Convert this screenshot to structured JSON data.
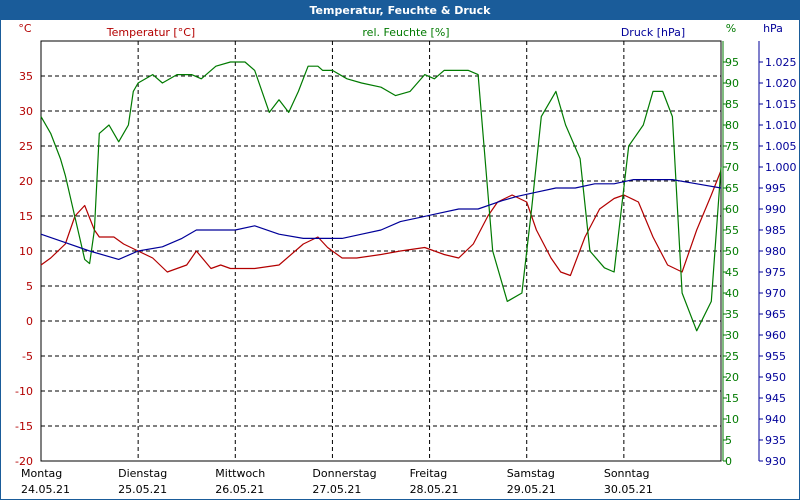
{
  "window": {
    "title": "Temperatur, Feuchte & Druck"
  },
  "colors": {
    "frame": "#1a5c9a",
    "temperature": "#b30000",
    "humidity": "#007a00",
    "pressure": "#000099",
    "grid": "#000000"
  },
  "chart_data": {
    "type": "line",
    "title": "Temperatur, Feuchte & Druck",
    "grid": true,
    "x_labels": [
      {
        "day": "Montag",
        "date": "24.05.21"
      },
      {
        "day": "Dienstag",
        "date": "25.05.21"
      },
      {
        "day": "Mittwoch",
        "date": "26.05.21"
      },
      {
        "day": "Donnerstag",
        "date": "27.05.21"
      },
      {
        "day": "Freitag",
        "date": "28.05.21"
      },
      {
        "day": "Samstag",
        "date": "29.05.21"
      },
      {
        "day": "Sonntag",
        "date": "30.05.21"
      }
    ],
    "xlim": [
      0,
      7
    ],
    "axes": {
      "temperature": {
        "label": "Temperatur [°C]",
        "unit": "°C",
        "range": [
          -20,
          40
        ],
        "ticks": [
          "35",
          "30",
          "25",
          "20",
          "15",
          "10",
          "5",
          "0",
          "-5",
          "-10",
          "-15",
          "-20"
        ]
      },
      "humidity": {
        "label": "rel. Feuchte [%]",
        "unit": "%",
        "range": [
          0,
          100
        ],
        "ticks": [
          "95",
          "90",
          "85",
          "80",
          "75",
          "70",
          "65",
          "60",
          "55",
          "50",
          "45",
          "40",
          "35",
          "30",
          "25",
          "20",
          "15",
          "10",
          "5",
          "0"
        ]
      },
      "pressure": {
        "label": "Druck [hPa]",
        "unit": "hPa",
        "range": [
          930,
          1030
        ],
        "ticks": [
          "1.025",
          "1.020",
          "1.015",
          "1.010",
          "1.005",
          "1.000",
          "995",
          "990",
          "985",
          "980",
          "975",
          "970",
          "965",
          "960",
          "955",
          "950",
          "945",
          "940",
          "935",
          "930"
        ]
      }
    },
    "series": [
      {
        "name": "Temperatur [°C]",
        "axis": "temperature",
        "x": [
          0,
          0.1,
          0.25,
          0.35,
          0.45,
          0.55,
          0.6,
          0.75,
          0.85,
          1.0,
          1.15,
          1.3,
          1.5,
          1.6,
          1.75,
          1.85,
          1.95,
          2.0,
          2.2,
          2.45,
          2.7,
          2.85,
          2.95,
          3.0,
          3.1,
          3.25,
          3.5,
          3.7,
          3.95,
          4.15,
          4.3,
          4.45,
          4.6,
          4.7,
          4.85,
          5.0,
          5.1,
          5.25,
          5.35,
          5.45,
          5.6,
          5.75,
          5.9,
          6.0,
          6.15,
          6.3,
          6.45,
          6.6,
          6.75,
          6.9,
          7.0
        ],
        "values": [
          8,
          9,
          11,
          15,
          16.5,
          13,
          12,
          12,
          11,
          10,
          9,
          7,
          8,
          10,
          7.5,
          8,
          7.5,
          7.5,
          7.5,
          8,
          11,
          12,
          10.5,
          10,
          9,
          9,
          9.5,
          10,
          10.5,
          9.5,
          9,
          11,
          15,
          17,
          18,
          17,
          13,
          9,
          7,
          6.5,
          12,
          16,
          17.5,
          18,
          17,
          12,
          8,
          7,
          13,
          18,
          21.5
        ]
      },
      {
        "name": "rel. Feuchte [%]",
        "axis": "humidity",
        "x": [
          0,
          0.1,
          0.2,
          0.25,
          0.35,
          0.45,
          0.5,
          0.55,
          0.6,
          0.7,
          0.8,
          0.9,
          0.95,
          1.0,
          1.15,
          1.25,
          1.4,
          1.55,
          1.65,
          1.8,
          1.95,
          2.1,
          2.2,
          2.35,
          2.45,
          2.55,
          2.65,
          2.75,
          2.85,
          2.9,
          3.0,
          3.15,
          3.3,
          3.5,
          3.65,
          3.8,
          3.95,
          4.05,
          4.15,
          4.3,
          4.4,
          4.5,
          4.65,
          4.8,
          4.95,
          5.05,
          5.15,
          5.3,
          5.4,
          5.55,
          5.65,
          5.8,
          5.9,
          6.05,
          6.2,
          6.3,
          6.4,
          6.5,
          6.6,
          6.75,
          6.9,
          7.0
        ],
        "values": [
          82,
          78,
          72,
          68,
          58,
          48,
          47,
          55,
          78,
          80,
          76,
          80,
          88,
          90,
          92,
          90,
          92,
          92,
          91,
          94,
          95,
          95,
          93,
          83,
          86,
          83,
          88,
          94,
          94,
          93,
          93,
          91,
          90,
          89,
          87,
          88,
          92,
          91,
          93,
          93,
          93,
          92,
          50,
          38,
          40,
          60,
          82,
          88,
          80,
          72,
          50,
          46,
          45,
          75,
          80,
          88,
          88,
          82,
          40,
          31,
          38,
          70
        ]
      },
      {
        "name": "Druck [hPa]",
        "axis": "pressure",
        "x": [
          0,
          0.25,
          0.5,
          0.8,
          1.0,
          1.25,
          1.45,
          1.6,
          1.8,
          2.0,
          2.2,
          2.45,
          2.7,
          2.9,
          3.1,
          3.3,
          3.5,
          3.7,
          3.9,
          4.1,
          4.3,
          4.5,
          4.75,
          4.9,
          5.1,
          5.3,
          5.5,
          5.7,
          5.9,
          6.1,
          6.3,
          6.5,
          6.75,
          7.0
        ],
        "values": [
          984,
          982,
          980,
          978,
          980,
          981,
          983,
          985,
          985,
          985,
          986,
          984,
          983,
          983,
          983,
          984,
          985,
          987,
          988,
          989,
          990,
          990,
          992,
          993,
          994,
          995,
          995,
          996,
          996,
          997,
          997,
          997,
          996,
          995
        ]
      }
    ]
  }
}
